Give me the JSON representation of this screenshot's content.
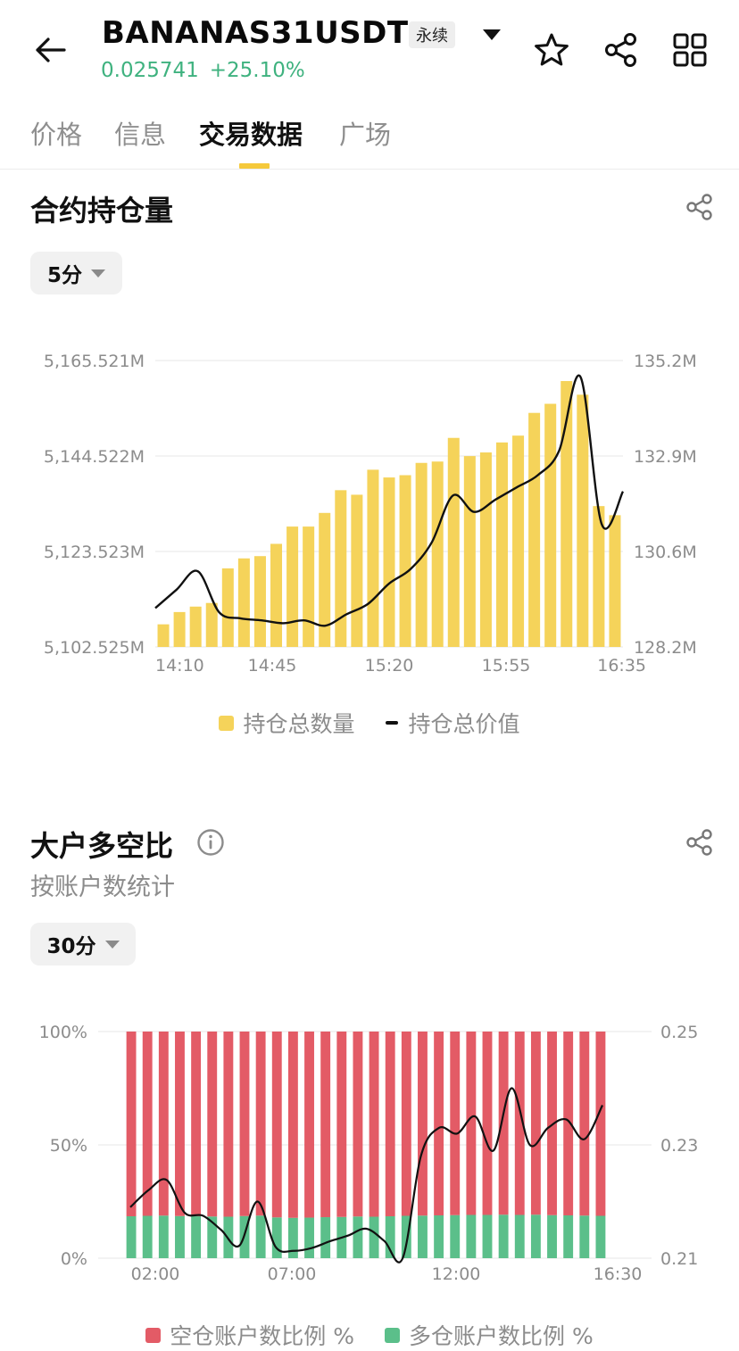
{
  "header": {
    "symbol": "BANANAS31USDT",
    "badge": "永续",
    "last_price": "0.025741",
    "change_pct": "+25.10%",
    "icons": [
      "back-arrow-icon",
      "dropdown-triangle-icon",
      "star-icon",
      "share-icon",
      "grid-icon"
    ]
  },
  "tabs": [
    {
      "label": "价格",
      "active": false
    },
    {
      "label": "信息",
      "active": false
    },
    {
      "label": "交易数据",
      "active": true
    },
    {
      "label": "广场",
      "active": false
    }
  ],
  "open_interest": {
    "title": "合约持仓量",
    "interval": "5分",
    "legend": {
      "bars": "持仓总数量",
      "line": "持仓总价值"
    }
  },
  "long_short": {
    "title": "大户多空比",
    "subtitle": "按账户数统计",
    "interval": "30分",
    "legend": {
      "short": "空仓账户数比例 %",
      "long": "多仓账户数比例 %"
    }
  },
  "colors": {
    "accent_yellow": "#f5d35a",
    "green": "#5bbf8a",
    "red": "#e35b66",
    "price_green": "#3fb27f"
  },
  "chart_data": [
    {
      "type": "bar",
      "name": "open-interest",
      "left_axis_ticks": [
        "5,165.521M",
        "5,144.522M",
        "5,123.523M",
        "5,102.525M"
      ],
      "right_axis_ticks": [
        "135.2M",
        "132.9M",
        "130.6M",
        "128.2M"
      ],
      "x_ticks": [
        "14:10",
        "14:45",
        "15:20",
        "15:55",
        "16:35"
      ],
      "ylim_left": [
        5102.525,
        5165.521
      ],
      "ylim_right": [
        128.2,
        135.2
      ],
      "series": [
        {
          "name": "持仓总数量",
          "type": "bar",
          "axis": "left",
          "values": [
            5107.5,
            5110.2,
            5111.4,
            5112.2,
            5119.8,
            5122.0,
            5122.5,
            5125.2,
            5129.0,
            5129.0,
            5132.0,
            5137.0,
            5136.0,
            5141.5,
            5139.8,
            5140.3,
            5143.0,
            5143.3,
            5148.5,
            5144.5,
            5145.3,
            5147.5,
            5149.0,
            5154.0,
            5156.0,
            5161.0,
            5158.0,
            5133.5,
            5131.5
          ],
          "color": "#f5d35a"
        },
        {
          "name": "持仓总价值",
          "type": "line",
          "axis": "right",
          "values": [
            129.15,
            129.6,
            130.05,
            129.05,
            128.9,
            128.85,
            128.78,
            128.85,
            128.72,
            129.0,
            129.25,
            129.75,
            130.1,
            130.75,
            131.9,
            131.5,
            131.8,
            132.1,
            132.4,
            133.0,
            134.8,
            131.2,
            132.0
          ],
          "color": "#111111"
        }
      ],
      "grid": true
    },
    {
      "type": "bar",
      "name": "top-trader-long-short-ratio",
      "left_axis_ticks": [
        "100%",
        "50%",
        "0%"
      ],
      "right_axis_ticks": [
        "0.25",
        "0.23",
        "0.21"
      ],
      "x_ticks": [
        "02:00",
        "07:00",
        "12:00",
        "16:30"
      ],
      "ylim_left": [
        0,
        100
      ],
      "ylim_right": [
        0.21,
        0.25
      ],
      "series": [
        {
          "name": "空仓账户数比例 %",
          "type": "stacked-bar",
          "values": [
            81.5,
            81.3,
            81.2,
            81.4,
            81.5,
            81.6,
            81.7,
            81.4,
            81.2,
            82.0,
            82.2,
            82.1,
            81.9,
            81.8,
            81.6,
            81.7,
            81.5,
            81.3,
            81.2,
            81.1,
            81.0,
            80.9,
            80.9,
            80.8,
            80.9,
            80.8,
            81.0,
            81.1,
            81.2,
            81.3
          ],
          "color": "#e35b66"
        },
        {
          "name": "多仓账户数比例 %",
          "type": "stacked-bar",
          "values": [
            18.5,
            18.7,
            18.8,
            18.6,
            18.5,
            18.4,
            18.3,
            18.6,
            18.8,
            18.0,
            17.8,
            17.9,
            18.1,
            18.2,
            18.4,
            18.3,
            18.5,
            18.7,
            18.8,
            18.9,
            19.0,
            19.1,
            19.1,
            19.2,
            19.1,
            19.2,
            19.0,
            18.9,
            18.8,
            18.7
          ],
          "color": "#5bbf8a"
        },
        {
          "name": "ratio",
          "type": "line",
          "values": [
            0.219,
            0.222,
            0.2238,
            0.218,
            0.2175,
            0.215,
            0.2122,
            0.22,
            0.212,
            0.2113,
            0.2118,
            0.213,
            0.214,
            0.2152,
            0.213,
            0.21,
            0.228,
            0.233,
            0.232,
            0.235,
            0.229,
            0.24,
            0.23,
            0.233,
            0.2345,
            0.231,
            0.237
          ],
          "color": "#111111"
        }
      ],
      "grid": true
    }
  ]
}
